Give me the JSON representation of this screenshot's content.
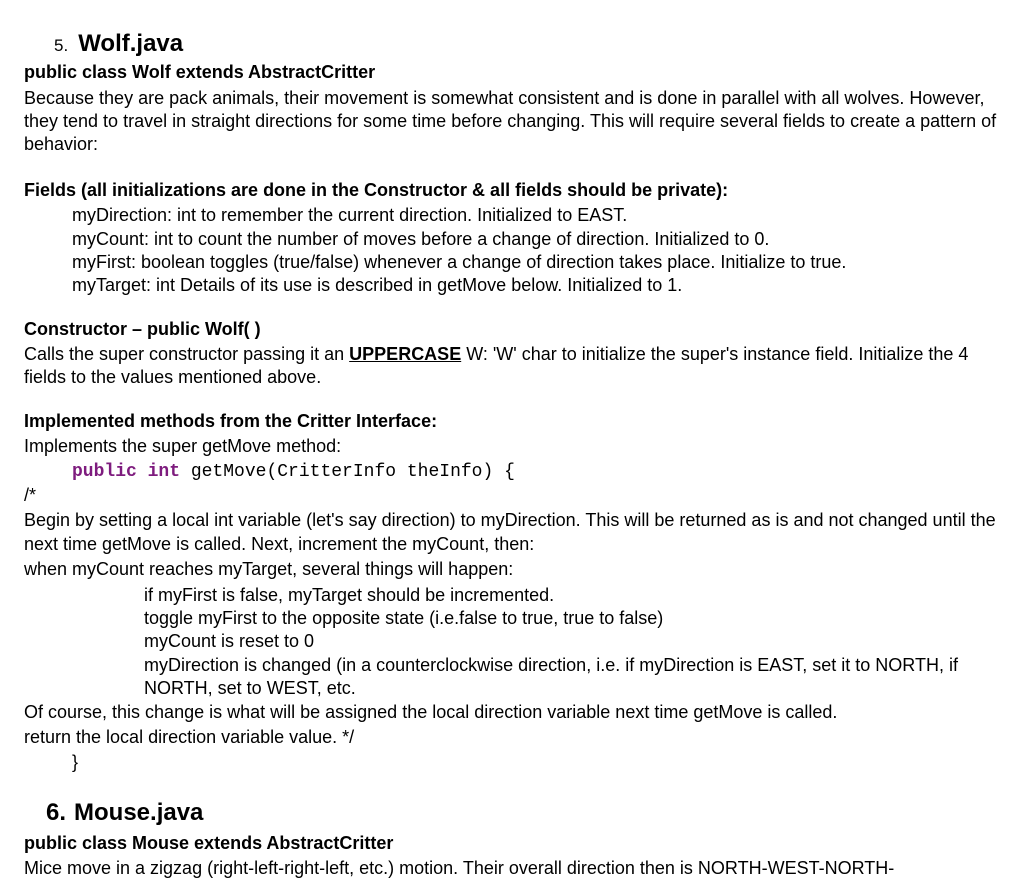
{
  "wolf": {
    "number": "5.",
    "title": "Wolf.java",
    "classDecl": "public class Wolf extends AbstractCritter",
    "intro": "Because they are pack animals, their movement is somewhat consistent and is done in parallel with all wolves.  However, they tend to travel in straight directions for some time before changing.  This will require several fields to create a pattern of behavior:",
    "fieldsHeader": "Fields (all initializations are done in the Constructor & all fields should be private):",
    "fields": {
      "myDirection": "myDirection:  int to remember the current direction.  Initialized to EAST.",
      "myCount": "myCount:  int to count the number of moves before a change of direction.  Initialized to 0.",
      "myFirst": "myFirst:  boolean toggles (true/false) whenever a change of direction takes place.  Initialize to true.",
      "myTarget": "myTarget:  int Details of its use is described in getMove below.  Initialized to 1."
    },
    "constructorLabel": "Constructor –   public Wolf( )",
    "constructorDesc1a": "Calls the super constructor passing it an ",
    "constructorDesc1b": "UPPERCASE",
    "constructorDesc1c": " W:  'W' char to initialize the super's instance field.  Initialize the 4 fields to the values mentioned above.",
    "implHeader": "Implemented methods from the Critter Interface:",
    "implLine": "Implements the super getMove method:",
    "code": {
      "kw1": "public",
      "kw2": "int",
      "methodRest": " getMove(CritterInfo theInfo) {"
    },
    "commentOpen": "/*",
    "body1": "Begin by setting a local int variable (let's say direction) to myDirection.  This will be returned as is and not changed until the next time getMove is called.  Next, increment the myCount, then:",
    "body2": "when myCount reaches myTarget, several things will happen:",
    "logic": {
      "l1": "if myFirst is false, myTarget should be incremented.",
      "l2": "toggle myFirst to the opposite state (i.e.false to true, true to false)",
      "l3": "myCount is reset to 0",
      "l4": "myDirection is changed (in a counterclockwise direction, i.e. if myDirection is EAST, set it to NORTH, if NORTH, set to WEST, etc."
    },
    "body3": "Of course, this change is what will be assigned the local direction variable next time getMove is called.",
    "body4": "return the local direction variable value.   */",
    "closeBrace": "}"
  },
  "mouse": {
    "number": "6.",
    "title": "Mouse.java",
    "classDecl": "public class Mouse extends AbstractCritter",
    "intro": "Mice move in a zigzag (right-left-right-left, etc.) motion.  Their overall direction then is NORTH-WEST-NORTH-"
  }
}
